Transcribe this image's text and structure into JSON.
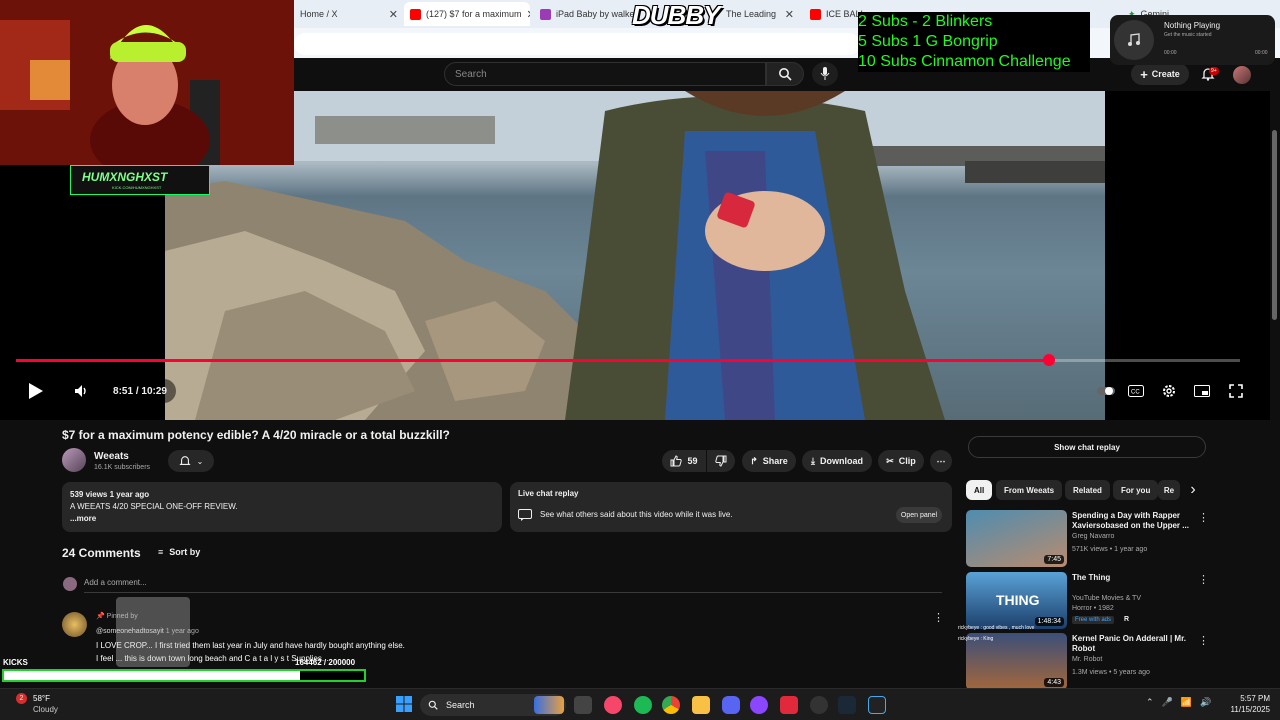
{
  "browser": {
    "tabs": [
      {
        "label": "Home / X",
        "active": false
      },
      {
        "label": "(127) $7 for a maximum",
        "active": true
      },
      {
        "label": "iPad Baby by walkedo",
        "active": false
      },
      {
        "label": "The Leading",
        "active": false
      },
      {
        "label": "ICE BALL FOR SPEEZE",
        "active": false
      },
      {
        "label": "Gemini",
        "active": false
      }
    ]
  },
  "youtube": {
    "search_placeholder": "Search",
    "create_label": "Create",
    "notif_count": "9+"
  },
  "overlays": {
    "dubby": "DUBBY",
    "subs_goals": [
      "2 Subs - 2 Blinkers",
      "5 Subs 1 G Bongrip",
      "10 Subs Cinnamon Challenge"
    ],
    "cam_tag": "HUMXNGHXST",
    "cam_tag_sub": "KICK.COM/HUMXNGHXST",
    "music_title": "Nothing Playing",
    "music_sub": "Get the music started",
    "music_time_start": "00:00",
    "music_time_end": "00:00",
    "kicks_label": "KICKS",
    "goal_text": "164462 / 200000",
    "goal_fraction": 0.822,
    "chat1": "rickybeye : good vibes , much love",
    "chat2": "rickybeye : King"
  },
  "player": {
    "time": "8:51 / 10:29",
    "progress_fraction": 0.8442
  },
  "video": {
    "title": "$7 for a maximum potency edible? A 4/20 miracle or a total buzzkill?",
    "channel": "Weeats",
    "subscribers": "16.1K subscribers",
    "likes": "59",
    "share_label": "Share",
    "download_label": "Download",
    "clip_label": "Clip",
    "views_line": "539 views  1 year ago",
    "description": "A WEEATS 4/20 SPECIAL ONE-OFF REVIEW.",
    "more": "...more",
    "live_title": "Live chat replay",
    "live_text": "See what others said about this video while it was live.",
    "open_panel": "Open panel"
  },
  "comments": {
    "count": "24 Comments",
    "sort_label": "Sort by",
    "add_placeholder": "Add a comment...",
    "pinned": "Pinned by",
    "author": "@someonehadtosayit",
    "age": "1 year ago",
    "line1": "I LOVE CROP... I first tried them last year in July and have hardly bought anything else.",
    "line2": "I feel ... this is down town long beach and C a t a l y s t Supplies..."
  },
  "sidebar": {
    "show_chat": "Show chat replay",
    "chips": [
      "All",
      "From Weeats",
      "Related",
      "For you",
      "Re"
    ],
    "recs": [
      {
        "title": "Spending a Day with Rapper Xaviersobased on the Upper ...",
        "channel": "Greg Navarro",
        "meta": "571K views • 1 year ago",
        "duration": "7:45",
        "badge": ""
      },
      {
        "title": "The Thing",
        "channel": "YouTube Movies & TV",
        "meta": "Horror • 1982",
        "duration": "1:48:34",
        "badge": "Free with ads",
        "rating": "R"
      },
      {
        "title": "Kernel Panic On Adderall | Mr. Robot",
        "channel": "Mr. Robot",
        "meta": "1.3M views • 5 years ago",
        "duration": "4:43",
        "badge": ""
      }
    ]
  },
  "taskbar": {
    "temp": "58°F",
    "weather": "Cloudy",
    "weather_badge": "2",
    "search": "Search",
    "time": "5:57 PM",
    "date": "11/15/2025"
  }
}
